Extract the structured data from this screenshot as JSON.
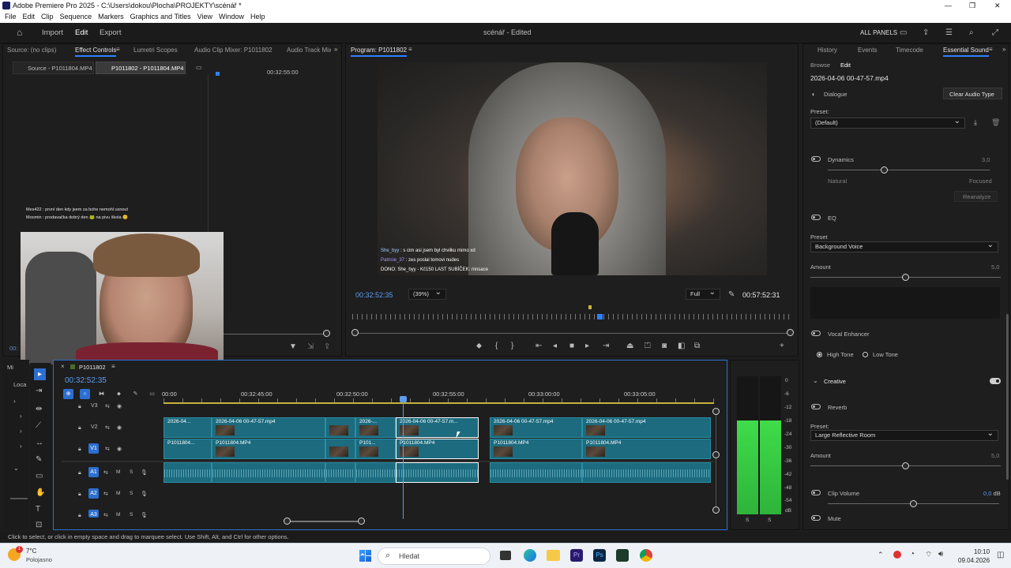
{
  "window": {
    "title": "Adobe Premiere Pro 2025 - C:\\Users\\dokou\\Plocha\\PROJEKTY\\scénář *",
    "controls": [
      "—",
      "❐",
      "✕"
    ]
  },
  "menu": [
    "File",
    "Edit",
    "Clip",
    "Sequence",
    "Markers",
    "Graphics and Titles",
    "View",
    "Window",
    "Help"
  ],
  "header": {
    "import": "Import",
    "edit": "Edit",
    "export": "Export",
    "project": "scénář - Edited",
    "all_panels": "ALL PANELS"
  },
  "source_panel": {
    "tabs": [
      "Source: (no clips)",
      "Effect Controls",
      "Lumetri Scopes",
      "Audio Clip Mixer: P1011802",
      "Audio Track Mixer"
    ],
    "sub_tabs": [
      "Source - P1011804.MP4",
      "P1011802 - P1011804.MP4"
    ],
    "timecode": "00:32:55:00",
    "corner_time": "00:"
  },
  "chat_overlay": {
    "line1": "Mes422 : první den kdy jsem za bohe nemohl usnout",
    "line2": "Moomin : prodavačka dobrý den 🐸 na pivu škola 😊"
  },
  "program": {
    "title": "Program: P1011802",
    "timecode": "00:32:52:35",
    "zoom": "(39%)",
    "quality": "Full",
    "duration": "00:57:52:31",
    "chat": {
      "l1_user": "She_byy",
      "l1_text": ": s cim asi jsem byl chvilku mimo xd",
      "l2_user": "Patricie_37",
      "l2_text": ": zes poslal tomovi nudes",
      "l3": "DONO: She_byy - Kč150   LAST SUBÍČEK: mnsace"
    }
  },
  "timeline": {
    "name": "P1011802",
    "timecode": "00:32:52:35",
    "ruler": [
      "00:00",
      "00:32:45:00",
      "00:32:50:00",
      "00:32:55:00",
      "00:33:00:00",
      "00:33:05:00"
    ],
    "tracks": [
      "V3",
      "V2",
      "V1",
      "A1",
      "A2",
      "A3"
    ],
    "track_letters": {
      "m": "M",
      "s": "S"
    },
    "v2_clips": [
      "2026-04...",
      "2026-04-06 00-47-57.mp4",
      "",
      "2026-...",
      "2026-04-06 00-47-57.m...",
      "2026-04-06 00-47-57.mp4",
      "2026-04-06 00-47-57.mp4"
    ],
    "v1_clips": [
      "P1011804...",
      "P1011804.MP4",
      "",
      "P101...",
      "P1011804.MP4",
      "P1011804.MP4",
      "P1011804.MP4"
    ],
    "left_strip": [
      "Mi",
      "Loca"
    ]
  },
  "meter": {
    "scale": [
      "0",
      "-6",
      "-12",
      "-18",
      "-24",
      "-30",
      "-36",
      "-42",
      "-48",
      "-54",
      "dB"
    ],
    "solo": [
      "S",
      "S"
    ]
  },
  "right_panel": {
    "tabs": [
      "History",
      "Events",
      "Timecode",
      "Essential Sound"
    ],
    "sub_tabs": [
      "Browse",
      "Edit"
    ],
    "clip": "2026-04-06 00-47-57.mp4",
    "type": "Dialogue",
    "clear": "Clear Audio Type",
    "preset_label": "Preset:",
    "preset_value": "(Default)",
    "dynamics": {
      "label": "Dynamics",
      "value": "3,0",
      "low": "Natural",
      "high": "Focused",
      "button": "Reanalyze",
      "level": 0.35
    },
    "eq": {
      "label": "EQ",
      "preset_label": "Preset",
      "preset_value": "Background Voice",
      "amount_label": "Amount",
      "amount_value": "5,0",
      "level": 0.5
    },
    "vocal": {
      "label": "Vocal Enhancer",
      "high": "High Tone",
      "low": "Low Tone"
    },
    "creative": {
      "label": "Creative"
    },
    "reverb": {
      "label": "Reverb",
      "preset_label": "Preset:",
      "preset_value": "Large Reflective Room",
      "amount_label": "Amount",
      "amount_value": "5,0",
      "level": 0.5
    },
    "clip_volume": {
      "label": "Clip Volume",
      "value": "0,0",
      "unit": "dB",
      "level": 0.5
    },
    "mute": {
      "label": "Mute"
    }
  },
  "status": "Click to select, or click in empty space and drag to marquee select. Use Shift, Alt, and Ctrl for other options.",
  "taskbar": {
    "temp": "7°C",
    "weather": "Polojasno",
    "search": "Hledat",
    "time": "10:10",
    "date": "09.04.2026",
    "badge": "1"
  }
}
